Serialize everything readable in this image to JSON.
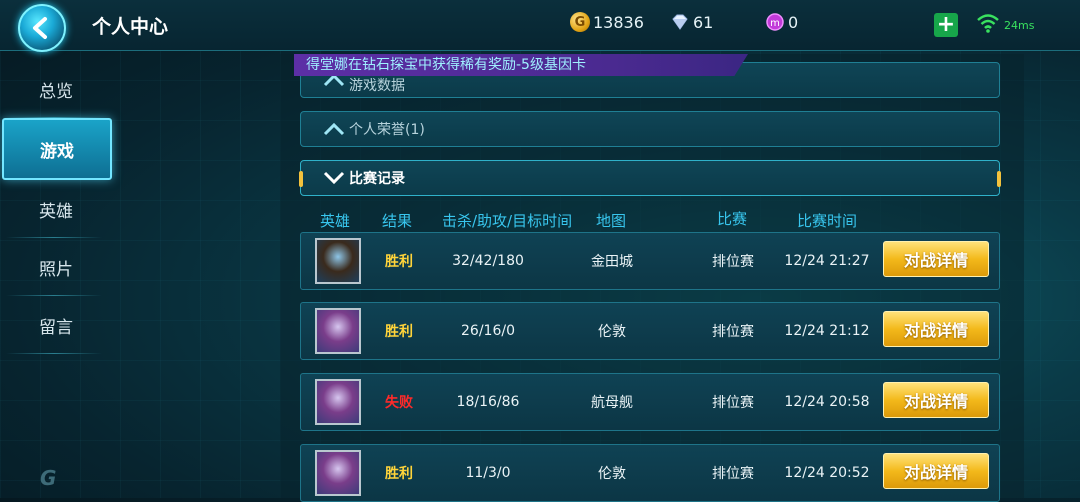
{
  "header": {
    "title": "个人中心",
    "gold": "13836",
    "diamond": "61",
    "gem": "0",
    "ping": "24ms"
  },
  "sidebar": {
    "items": [
      {
        "label": "总览",
        "active": false
      },
      {
        "label": "游戏",
        "active": true
      },
      {
        "label": "英雄",
        "active": false
      },
      {
        "label": "照片",
        "active": false
      },
      {
        "label": "留言",
        "active": false
      }
    ]
  },
  "ticker": "得堂娜在钻石探宝中获得稀有奖励-5级基因卡",
  "sections": {
    "game_data": "游戏数据",
    "honors": "个人荣誉(1)",
    "matches": "比赛记录"
  },
  "columns": {
    "hero": "英雄",
    "result": "结果",
    "kda": "击杀/助攻/目标时间",
    "map": "地图",
    "mode": "比赛",
    "time": "比赛时间"
  },
  "matches": [
    {
      "result": "胜利",
      "kda": "32/42/180",
      "map": "金田城",
      "mode": "排位赛",
      "time": "12/24 21:27",
      "detail": "对战详情",
      "avatar_colors": [
        "#1e3f5c",
        "#8ec6e8",
        "#3a2a1c"
      ]
    },
    {
      "result": "胜利",
      "kda": "26/16/0",
      "map": "伦敦",
      "mode": "排位赛",
      "time": "12/24 21:12",
      "detail": "对战详情",
      "avatar_colors": [
        "#3d3b7a",
        "#d6c6ef",
        "#7a3d8a"
      ]
    },
    {
      "result": "失败",
      "kda": "18/16/86",
      "map": "航母舰",
      "mode": "排位赛",
      "time": "12/24 20:58",
      "detail": "对战详情",
      "avatar_colors": [
        "#3d3b7a",
        "#d6c6ef",
        "#7a3d8a"
      ]
    },
    {
      "result": "胜利",
      "kda": "11/3/0",
      "map": "伦敦",
      "mode": "排位赛",
      "time": "12/24 20:52",
      "detail": "对战详情",
      "avatar_colors": [
        "#3d3b7a",
        "#d6c6ef",
        "#7a3d8a"
      ]
    }
  ],
  "colors": {
    "win": "#ffd43a",
    "lose": "#ff2a2a",
    "accent": "#38c6ee",
    "button": "#f3b91b"
  }
}
